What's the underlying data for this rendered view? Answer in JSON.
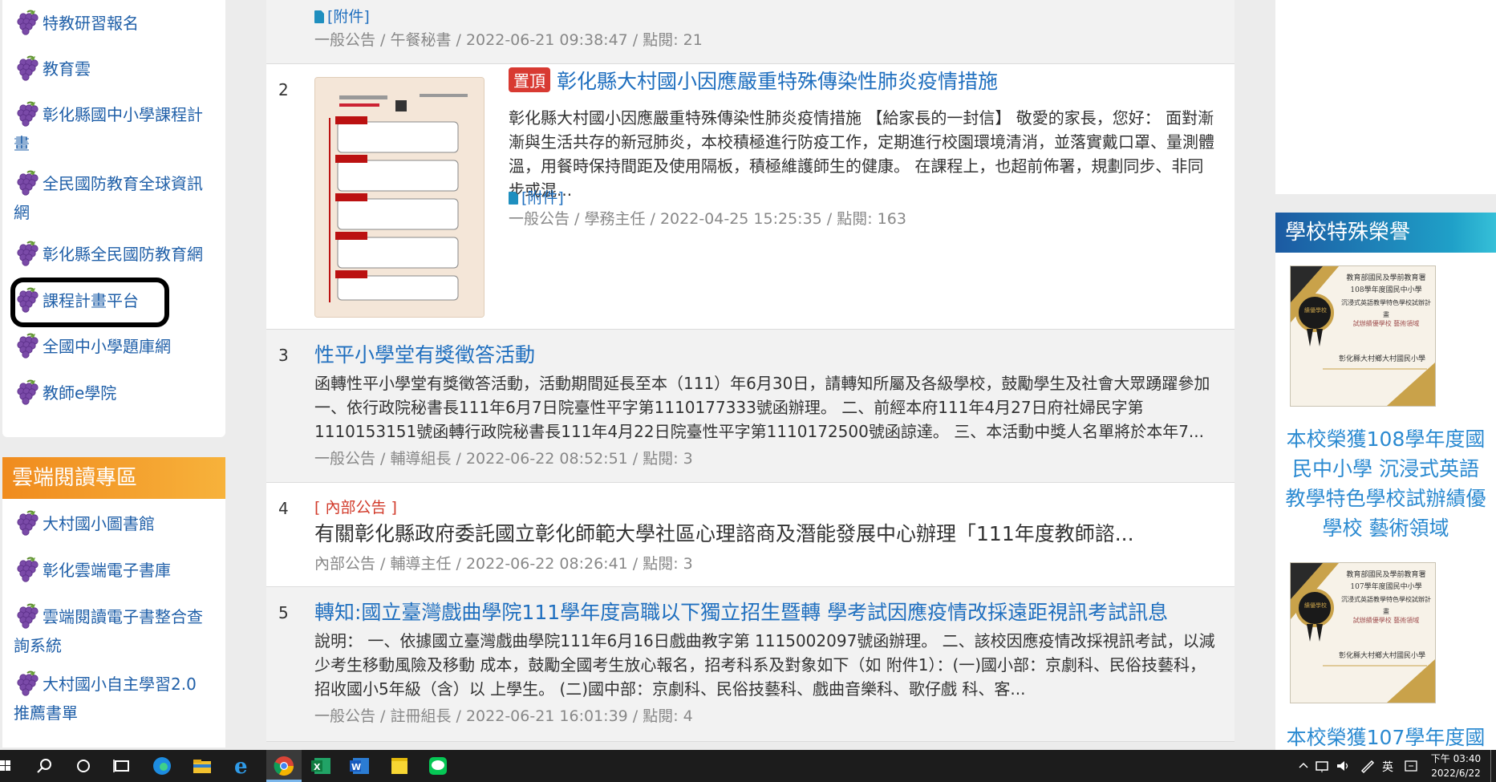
{
  "left_links": [
    {
      "label": "特教研習報名"
    },
    {
      "label": "教育雲"
    },
    {
      "label": "彰化縣國中小學課程計畫"
    },
    {
      "label": "全民國防教育全球資訊網"
    },
    {
      "label": "彰化縣全民國防教育網"
    },
    {
      "label": "課程計畫平台"
    },
    {
      "label": "全國中小學題庫網"
    },
    {
      "label": "教師e學院"
    }
  ],
  "cloud_section": {
    "title": "雲端閱讀專區",
    "links": [
      {
        "label": "大村國小圖書館"
      },
      {
        "label": "彰化雲端電子書庫"
      },
      {
        "label": "雲端閱讀電子書整合查詢系統"
      },
      {
        "label": "大村國小自主學習2.0推薦書單"
      }
    ]
  },
  "news": {
    "prev_item": {
      "attachment": "[附件]",
      "meta": "一般公告 / 午餐秘書 / 2022-06-21 09:38:47 / 點閱: 21"
    },
    "items": [
      {
        "num": "2",
        "badge": "置頂",
        "title": "彰化縣大村國小因應嚴重特殊傳染性肺炎疫情措施",
        "body": "彰化縣大村國小因應嚴重特殊傳染性肺炎疫情措施 【給家長的一封信】 敬愛的家長，您好： 面對漸漸與生活共存的新冠肺炎，本校積極進行防疫工作，定期進行校園環境清消，並落實戴口罩、量測體溫，用餐時保持間距及使用隔板，積極維護師生的健康。 在課程上，也超前佈署，規劃同步、非同步或混...",
        "attachment": "[附件]",
        "meta": "一般公告 / 學務主任 / 2022-04-25 15:25:35 / 點閱: 163"
      },
      {
        "num": "3",
        "title": "性平小學堂有獎徵答活動",
        "body": "函轉性平小學堂有獎徵答活動，活動期間延長至本（111）年6月30日，請轉知所屬及各級學校，鼓勵學生及社會大眾踴躍參加 一、依行政院秘書長111年6月7日院臺性平字第1110177333號函辦理。 二、前經本府111年4月27日府社婦民字第1110153151號函轉行政院秘書長111年4月22日院臺性平字第1110172500號函諒達。 三、本活動中獎人名單將於本年7...",
        "meta": "一般公告 / 輔導組長 / 2022-06-22 08:52:51 / 點閱: 3"
      },
      {
        "num": "4",
        "tag": "[ 內部公告 ]",
        "title": "有關彰化縣政府委託國立彰化師範大學社區心理諮商及潛能發展中心辦理「111年度教師諮...",
        "meta": "內部公告 / 輔導主任 / 2022-06-22 08:26:41 / 點閱: 3"
      },
      {
        "num": "5",
        "title": "轉知:國立臺灣戲曲學院111學年度高職以下獨立招生暨轉 學考試因應疫情改採遠距視訊考試訊息",
        "body": "說明： 一、依據國立臺灣戲曲學院111年6月16日戲曲教字第 1115002097號函辦理。 二、該校因應疫情改採視訊考試，以減少考生移動風險及移動 成本，鼓勵全國考生放心報名，招考科系及對象如下（如 附件1）：(一)國小部：京劇科、民俗技藝科，招收國小5年級（含）以 上學生。 (二)國中部：京劇科、民俗技藝科、戲曲音樂科、歌仔戲 科、客...",
        "meta": "一般公告 / 註冊組長 / 2022-06-21 16:01:39 / 點閱: 4"
      }
    ]
  },
  "honors": {
    "title": "學校特殊榮譽",
    "items": [
      {
        "cert_lines": [
          "教育部國民及學前教育署",
          "108學年度國民中小學",
          "沉浸式英語教學特色學校試辦計畫",
          "試辦績優學校 藝術領域",
          "彰化縣大村鄉大村國民小學"
        ],
        "seal": "績優學校",
        "caption": "本校榮獲108學年度國民中小學 沉浸式英語教學特色學校試辦績優學校 藝術領域"
      },
      {
        "cert_lines": [
          "教育部國民及學前教育署",
          "107學年度國民中小學",
          "沉浸式英語教學特色學校試辦計畫",
          "試辦績優學校 藝術領域",
          "彰化縣大村鄉大村國民小學"
        ],
        "seal": "績優學校",
        "caption": "本校榮獲107學年度國"
      }
    ]
  },
  "taskbar": {
    "ime": "英",
    "time": "下午 03:40",
    "date": "2022/6/22"
  },
  "colors": {
    "link": "#1f6fbf",
    "pin": "#d83a32",
    "cloud_header": "#f29a27",
    "honor_header": "#1c5aa2"
  }
}
